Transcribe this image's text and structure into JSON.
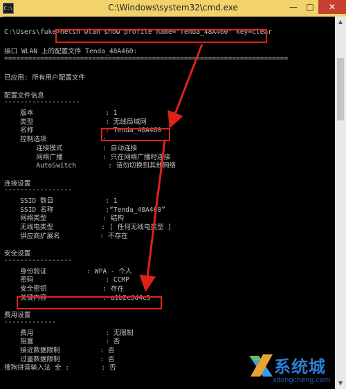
{
  "window": {
    "title": "C:\\Windows\\system32\\cmd.exe",
    "min_label": "—",
    "max_label": "□",
    "close_label": "✕",
    "icon_text": "C:\\"
  },
  "console": {
    "lines": [
      "",
      "C:\\Users\\fuke>netsh wlan show profile name=\"Tenda_48A460\" key=clear",
      "",
      "接口 WLAN 上的配置文件 Tenda_48A460:",
      "=======================================================================",
      "",
      "已应用: 所有用户配置文件",
      "",
      "配置文件信息",
      "-------------------",
      "    版本                  : 1",
      "    类型                  : 无线局域网",
      "    名称                  : Tenda_48A460",
      "    控制选项              :",
      "        连接模式          : 自动连接",
      "        网络广播          : 只在网络广播时连接",
      "        AutoSwitch        : 请勿切换到其他网络",
      "",
      "连接设置",
      "-----------------",
      "    SSID 数目             : 1",
      "    SSID 名称             :“Tenda_48A460”",
      "    网络类型              : 结构",
      "    无线电类型            : [ 任何无线电类型 ]",
      "    供应商扩展名          : 不存在",
      "",
      "安全设置",
      "-----------------",
      "    身份验证          : WPA - 个人",
      "    密码                  : CCMP",
      "    安全密钥              : 存在",
      "    关键内容              : a1b2c3d4e5",
      "",
      "费用设置",
      "-------------",
      "    费用                  : 无限制",
      "    阻塞                  : 否",
      "    接近数据限制          : 否",
      "    过量数据限制          : 否",
      "搜狗拼音输入法 全 :        : 否"
    ]
  },
  "logo": {
    "name": "系统城",
    "url": "xitongcheng.com"
  },
  "colors": {
    "titlebar": "#f2d36b",
    "highlight": "#e0211b",
    "console_text": "#c0c0c0",
    "close": "#c7402f",
    "logo_blue": "#2a7fd4"
  }
}
